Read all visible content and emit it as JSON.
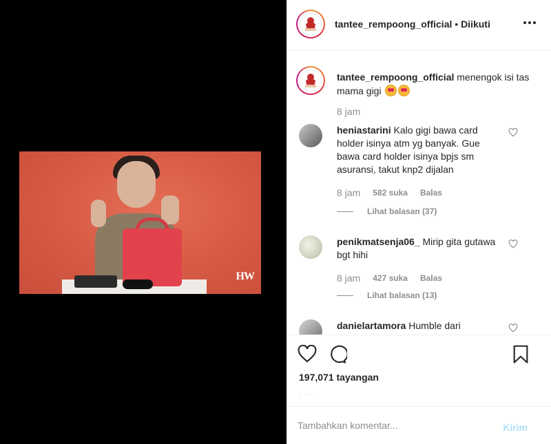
{
  "header": {
    "username": "tantee_rempoong_official",
    "separator": "•",
    "follow_status": "Diikuti",
    "more_icon": "more-horizontal-icon"
  },
  "media": {
    "watermark": "HW"
  },
  "caption": {
    "username": "tantee_rempoong_official",
    "text": "menengok isi tas mama gigi",
    "time": "8 jam"
  },
  "comments": [
    {
      "username": "heniastarini",
      "text": "Kalo gigi bawa card holder isinya atm yg banyak. Gue bawa card holder isinya bpjs sm asuransi, takut knp2 dijalan",
      "time": "8 jam",
      "likes": "582 suka",
      "reply": "Balas",
      "view_replies": "Lihat balasan (37)"
    },
    {
      "username": "penikmatsenja06_",
      "text": "Mirip gita gutawa bgt hihi",
      "time": "8 jam",
      "likes": "427 suka",
      "reply": "Balas",
      "view_replies": "Lihat balasan (13)"
    },
    {
      "username": "danielartamora",
      "text": "Humble dari",
      "time": "",
      "likes": "",
      "reply": "",
      "view_replies": ""
    }
  ],
  "actions": {
    "like_icon": "heart-icon",
    "comment_icon": "comment-icon",
    "save_icon": "bookmark-icon",
    "views": "197,071 tayangan"
  },
  "comment_bar": {
    "placeholder": "Tambahkan komentar...",
    "post_label": "Kirim"
  }
}
